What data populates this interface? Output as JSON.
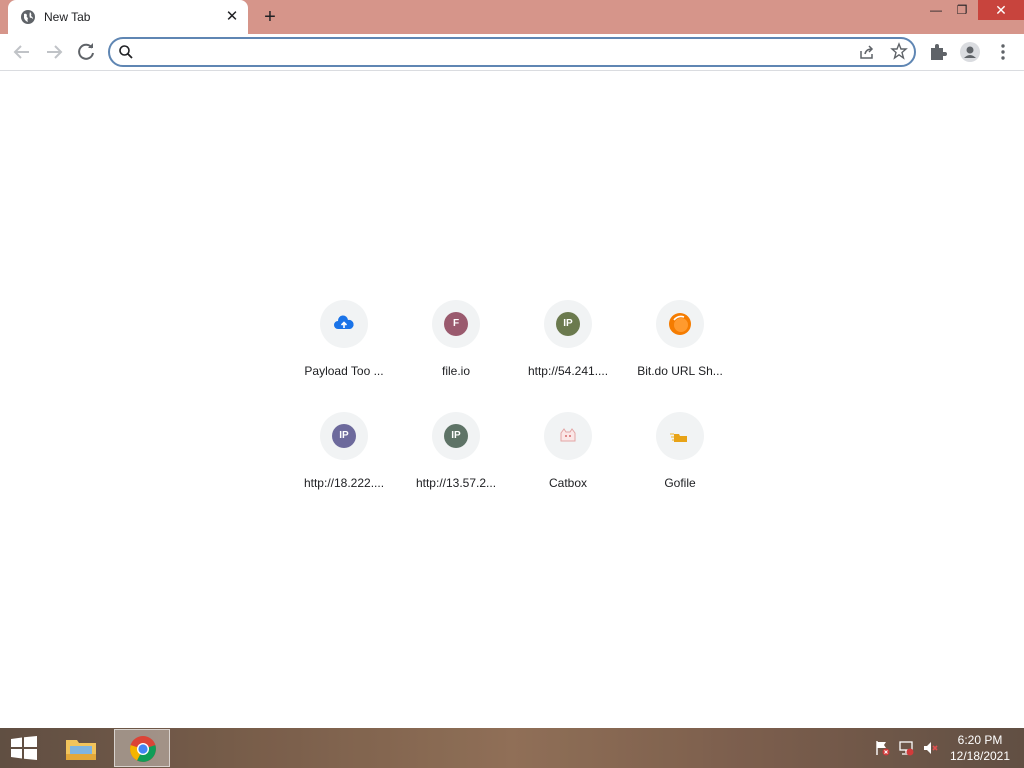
{
  "browser": {
    "tab": {
      "title": "New Tab",
      "close_label": "✕"
    },
    "new_tab_label": "+",
    "window_controls": {
      "minimize": "—",
      "maximize": "❐",
      "close": "✕"
    },
    "omnibox": {
      "value": "",
      "placeholder": ""
    }
  },
  "shortcuts": [
    {
      "label": "Payload Too ...",
      "icon": "cloud-upload-icon",
      "color": "#1a73e8",
      "glyph": ""
    },
    {
      "label": "file.io",
      "icon": "letter-f-icon",
      "color": "#9a5a6e",
      "glyph": "F"
    },
    {
      "label": "http://54.241....",
      "icon": "ip-icon",
      "color": "#6b7a4e",
      "glyph": "IP"
    },
    {
      "label": "Bit.do URL Sh...",
      "icon": "orange-ball-icon",
      "color": "#f57c00",
      "glyph": ""
    },
    {
      "label": "http://18.222....",
      "icon": "ip-icon",
      "color": "#6d6a9c",
      "glyph": "IP"
    },
    {
      "label": "http://13.57.2...",
      "icon": "ip-icon",
      "color": "#5e7366",
      "glyph": "IP"
    },
    {
      "label": "Catbox",
      "icon": "catbox-icon",
      "color": "#f5d2d2",
      "glyph": ""
    },
    {
      "label": "Gofile",
      "icon": "gofile-icon",
      "color": "#e8a317",
      "glyph": ""
    }
  ],
  "taskbar": {
    "time": "6:20 PM",
    "date": "12/18/2021"
  }
}
